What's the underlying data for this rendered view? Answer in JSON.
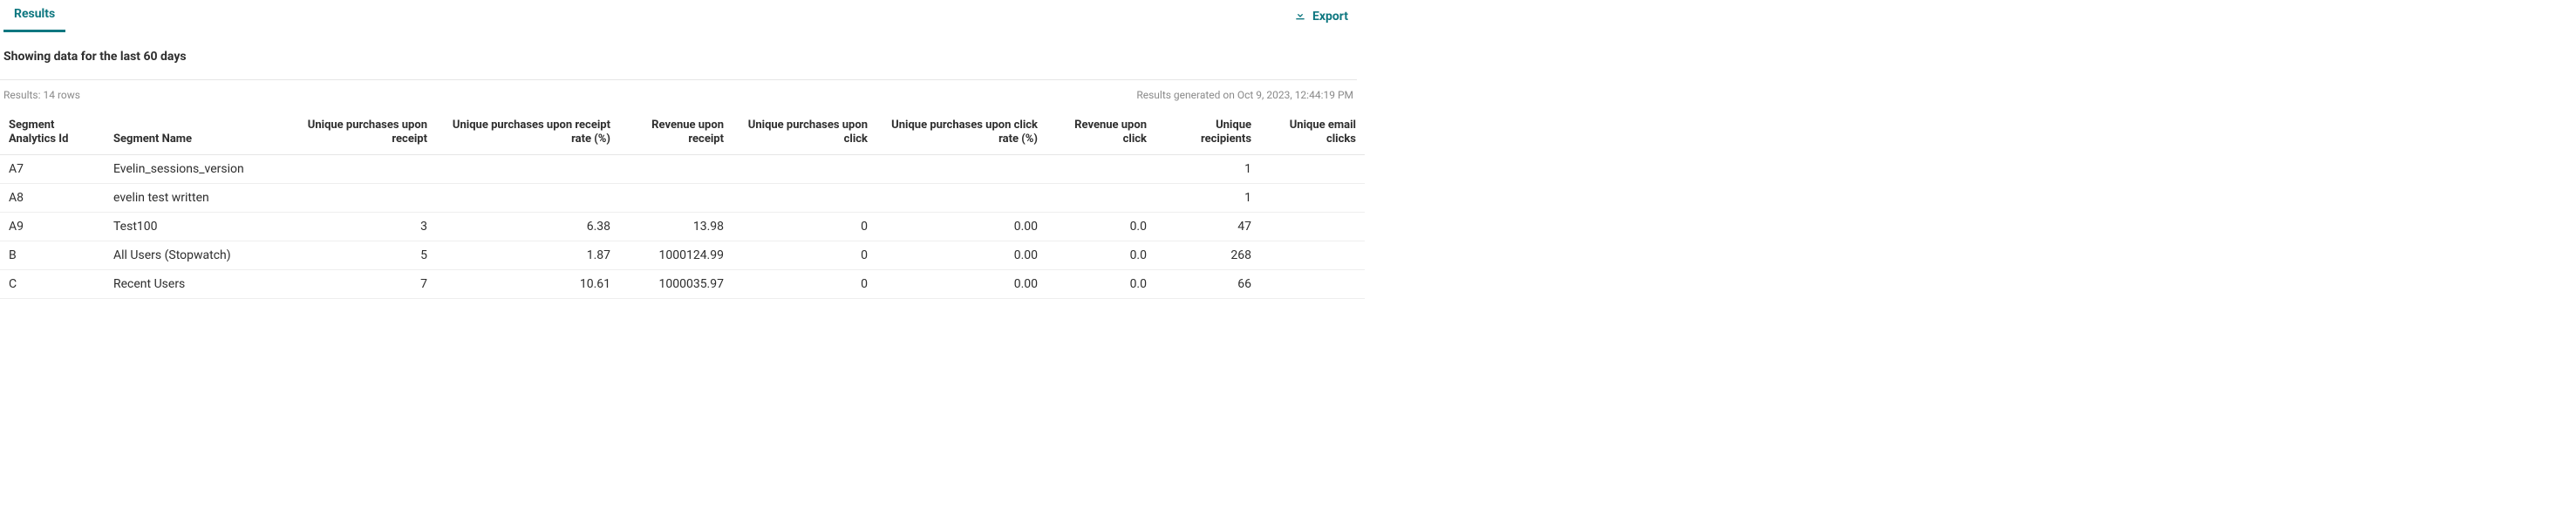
{
  "tabs": {
    "results": "Results"
  },
  "export_label": "Export",
  "subtitle": "Showing data for the last 60 days",
  "results_count_label": "Results: 14 rows",
  "generated_label": "Results generated on Oct 9, 2023, 12:44:19 PM",
  "columns": {
    "id": "Segment Analytics Id",
    "name": "Segment Name",
    "upr": "Unique purchases upon receipt",
    "upr_rate": "Unique purchases upon receipt rate (%)",
    "rur": "Revenue upon receipt",
    "upc": "Unique purchases upon click",
    "upc_rate": "Unique purchases upon click rate (%)",
    "ruc": "Revenue upon click",
    "recipients": "Unique recipients",
    "uec": "Unique email clicks"
  },
  "rows": [
    {
      "id": "A7",
      "name": "Evelin_sessions_version",
      "upr": "",
      "upr_rate": "",
      "rur": "",
      "upc": "",
      "upc_rate": "",
      "ruc": "",
      "recipients": "1",
      "uec": ""
    },
    {
      "id": "A8",
      "name": "evelin test written",
      "upr": "",
      "upr_rate": "",
      "rur": "",
      "upc": "",
      "upc_rate": "",
      "ruc": "",
      "recipients": "1",
      "uec": ""
    },
    {
      "id": "A9",
      "name": "Test100",
      "upr": "3",
      "upr_rate": "6.38",
      "rur": "13.98",
      "upc": "0",
      "upc_rate": "0.00",
      "ruc": "0.0",
      "recipients": "47",
      "uec": ""
    },
    {
      "id": "B",
      "name": "All Users (Stopwatch)",
      "upr": "5",
      "upr_rate": "1.87",
      "rur": "1000124.99",
      "upc": "0",
      "upc_rate": "0.00",
      "ruc": "0.0",
      "recipients": "268",
      "uec": ""
    },
    {
      "id": "C",
      "name": "Recent Users",
      "upr": "7",
      "upr_rate": "10.61",
      "rur": "1000035.97",
      "upc": "0",
      "upc_rate": "0.00",
      "ruc": "0.0",
      "recipients": "66",
      "uec": ""
    }
  ]
}
